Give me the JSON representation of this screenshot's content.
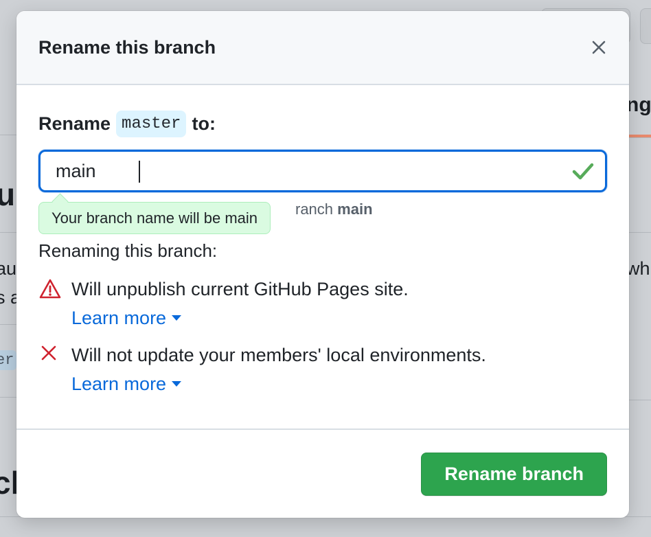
{
  "background": {
    "fragments": [
      "ul",
      "au",
      "s a",
      "er",
      "ng",
      "whi",
      "ch"
    ]
  },
  "modal": {
    "title": "Rename this branch",
    "rename_prefix": "Rename",
    "current_branch": "master",
    "rename_suffix": "to:",
    "input_value": "main",
    "hint_prefix": "ranch",
    "hint_branch": "main",
    "tooltip": "Your branch name will be main",
    "renaming_heading": "Renaming this branch:",
    "consequences": [
      {
        "icon": "alert-icon",
        "text": "Will unpublish current GitHub Pages site.",
        "link": "Learn more"
      },
      {
        "icon": "x-icon",
        "text": "Will not update your members' local environments.",
        "link": "Learn more"
      }
    ],
    "submit_label": "Rename branch"
  },
  "colors": {
    "accent": "#0969da",
    "success": "#2da44e",
    "danger": "#cf222e",
    "tooltip_bg": "#dafbe1"
  }
}
